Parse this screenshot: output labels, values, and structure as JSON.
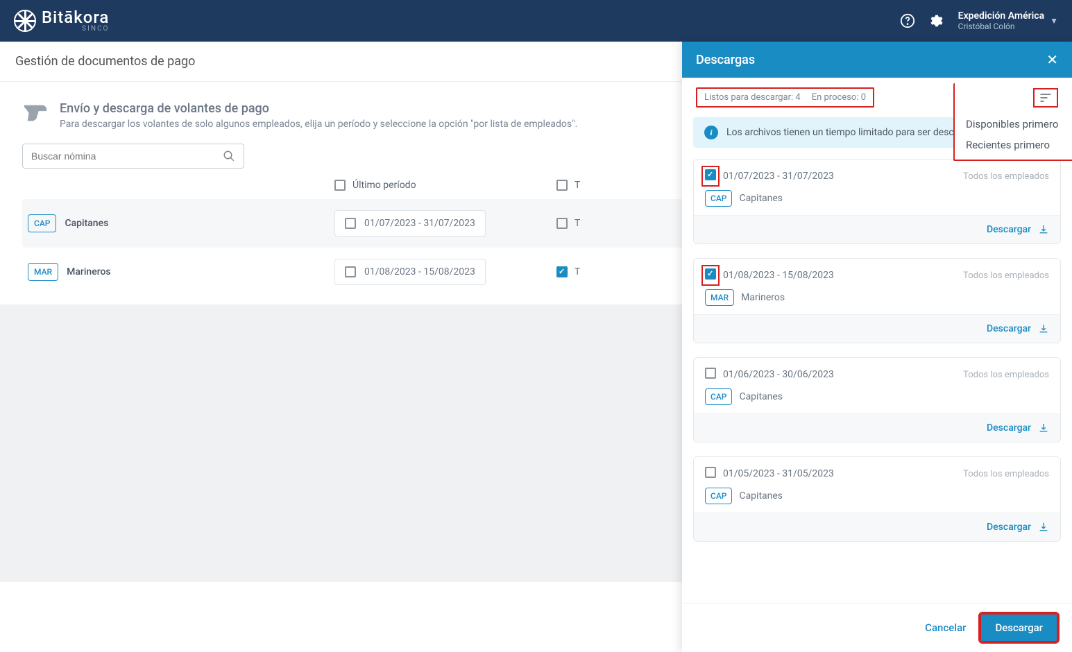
{
  "header": {
    "logo_main": "Bitākora",
    "logo_sub": "SINCO",
    "org": "Expedición América",
    "user": "Cristóbal Colón"
  },
  "page": {
    "title": "Gestión de documentos de pago",
    "section_title": "Envío y descarga de volantes de pago",
    "section_desc": "Para descargar los volantes de solo algunos empleados, elija un período y seleccione la opción \"por lista de empleados\".",
    "search_placeholder": "Buscar nómina",
    "col_periodo": "Último período",
    "col_todos": "T"
  },
  "rows": [
    {
      "badge": "CAP",
      "name": "Capitanes",
      "period": "01/07/2023 - 31/07/2023",
      "period_border": true,
      "todos_checked": false
    },
    {
      "badge": "MAR",
      "name": "Marineros",
      "period": "01/08/2023 - 15/08/2023",
      "period_border": true,
      "todos_checked": true
    }
  ],
  "panel": {
    "title": "Descargas",
    "ready_label": "Listos para descargar: 4",
    "proc_label": "En proceso: 0",
    "sort_opt1": "Disponibles primero",
    "sort_opt2": "Recientes primero",
    "info_text": "Los archivos tienen un tiempo limitado para ser descar",
    "download_label": "Descargar",
    "cancel": "Cancelar",
    "primary": "Descargar",
    "scope": "Todos los empleados"
  },
  "downloads": [
    {
      "checked": true,
      "highlight": true,
      "date": "01/07/2023 - 31/07/2023",
      "badge": "CAP",
      "name": "Capitanes"
    },
    {
      "checked": true,
      "highlight": true,
      "date": "01/08/2023 - 15/08/2023",
      "badge": "MAR",
      "name": "Marineros"
    },
    {
      "checked": false,
      "highlight": false,
      "date": "01/06/2023 - 30/06/2023",
      "badge": "CAP",
      "name": "Capitanes"
    },
    {
      "checked": false,
      "highlight": false,
      "date": "01/05/2023 - 31/05/2023",
      "badge": "CAP",
      "name": "Capitanes"
    }
  ]
}
